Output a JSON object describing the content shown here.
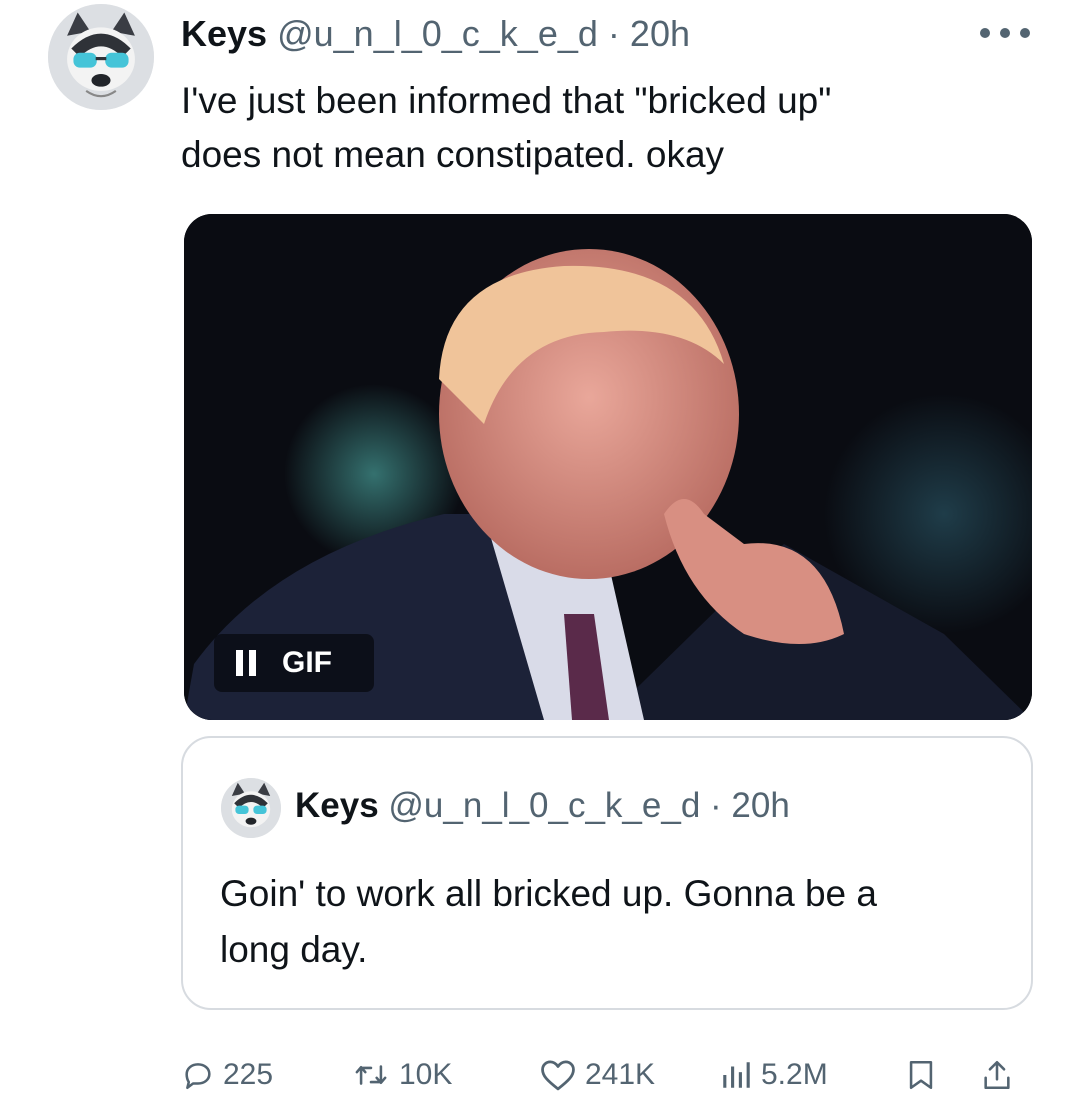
{
  "tweet": {
    "author_name": "Keys",
    "handle": "@u_n_l_0_c_k_e_d",
    "separator": "·",
    "time": "20h",
    "text_line1": "I've just been informed that \"bricked up\"",
    "text_line2": "does not mean constipated. okay",
    "media": {
      "type": "gif",
      "badge_label": "GIF"
    }
  },
  "quote": {
    "author_name": "Keys",
    "handle": "@u_n_l_0_c_k_e_d",
    "separator": "·",
    "time": "20h",
    "text_line1": "Goin' to work all bricked up. Gonna be a",
    "text_line2": "long day."
  },
  "actions": {
    "replies": "225",
    "reposts": "10K",
    "likes": "241K",
    "views": "5.2M"
  },
  "icons": {
    "more": "more-horizontal-icon",
    "reply": "reply-icon",
    "repost": "repost-icon",
    "like": "heart-icon",
    "views": "views-chart-icon",
    "bookmark": "bookmark-icon",
    "share": "share-icon",
    "pause": "pause-icon"
  },
  "colors": {
    "text": "#0f1419",
    "secondary": "#536471",
    "border": "#d7dbe0"
  }
}
